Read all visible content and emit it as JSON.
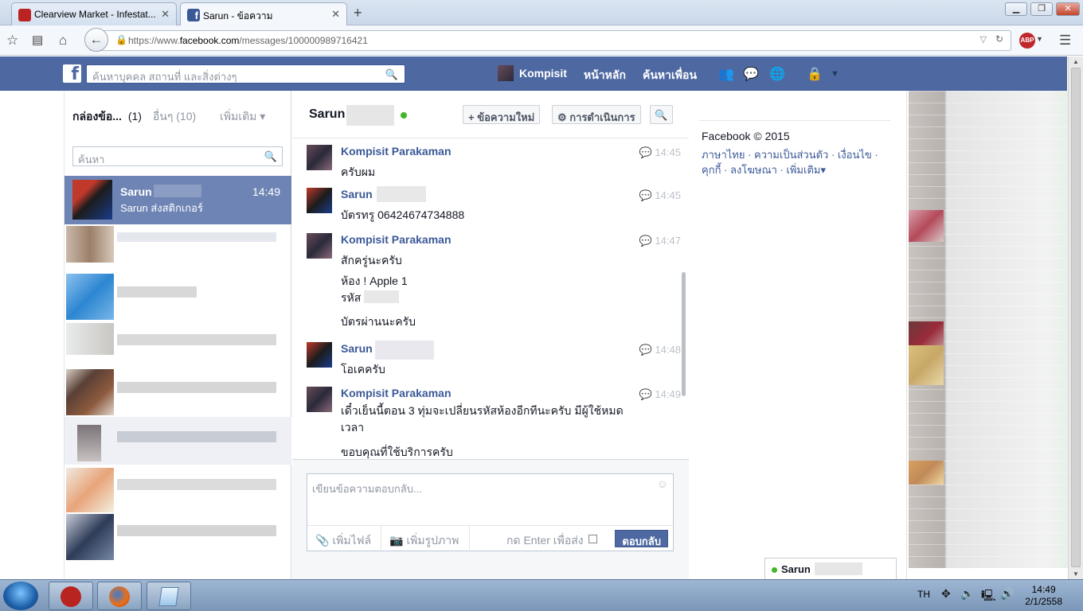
{
  "browser": {
    "tabs": [
      {
        "title": "Clearview Market - Infestat...",
        "active": false
      },
      {
        "title": "Sarun        - ข้อความ",
        "active": true
      }
    ],
    "url_prefix": "https://www.",
    "url_domain": "facebook.com",
    "url_path": "/messages/100000989716421"
  },
  "fb": {
    "logo": "f",
    "search_placeholder": "ค้นหาบุคคล สถานที่ และสิ่งต่างๆ",
    "profile_name": "Kompisit",
    "home": "หน้าหลัก",
    "find_friends": "ค้นหาเพื่อน"
  },
  "left": {
    "inbox_label": "กล่องข้อ...",
    "inbox_count": "(1)",
    "other_label": "อื่นๆ (10)",
    "more_label": "เพิ่มเติม ▾",
    "search_placeholder": "ค้นหา",
    "active_conv": {
      "name": "Sarun",
      "time": "14:49",
      "snippet": "Sarun ส่งสติกเกอร์"
    }
  },
  "thread_header": {
    "name": "Sarun",
    "new_message": "ข้อความใหม่",
    "actions": "การดำเนินการ"
  },
  "messages": [
    {
      "sender": "Kompisit Parakaman",
      "time": "14:45",
      "lines": [
        "ครับผม"
      ]
    },
    {
      "sender": "Sarun",
      "time": "14:45",
      "lines": [
        "บัตรทรู 06424674734888"
      ]
    },
    {
      "sender": "Kompisit Parakaman",
      "time": "14:47",
      "lines": [
        "สักครู่นะครับ"
      ]
    },
    {
      "sender": "",
      "time": "",
      "lines": [
        "ห้อง ! Apple 1",
        "รหัส"
      ]
    },
    {
      "sender": "",
      "time": "",
      "lines": [
        "บัตรผ่านนะครับ"
      ]
    },
    {
      "sender": "Sarun",
      "time": "14:48",
      "lines": [
        "โอเคครับ"
      ]
    },
    {
      "sender": "Kompisit Parakaman",
      "time": "14:49",
      "lines": [
        "เดี๋วเย็นนี้ตอน 3 ทุ่มจะเปลี่ยนรหัสห้องอีกทีนะครับ มีผู้ใช้หมด",
        "เวลา"
      ]
    },
    {
      "sender": "",
      "time": "",
      "lines": [
        "ขอบคุณที่ใช้บริการครับ"
      ]
    }
  ],
  "composer": {
    "placeholder": "เขียนข้อความตอบกลับ...",
    "add_files": "เพิ่มไฟล์",
    "add_photos": "เพิ่มรูปภาพ",
    "press_enter": "กด Enter เพื่อส่ง",
    "reply_button": "ตอบกลับ"
  },
  "right": {
    "copyright": "Facebook © 2015",
    "links1": "ภาษาไทย · ความเป็นส่วนตัว · เงื่อนไข ·",
    "links2": "คุกกี้ · ลงโฆษณา · เพิ่มเติม▾"
  },
  "chat_tab": {
    "name": "Sarun"
  },
  "taskbar": {
    "lang": "TH",
    "time": "14:49",
    "date": "2/1/2558"
  },
  "colors": {
    "fb_blue": "#4e69a2",
    "link_blue": "#3b5998",
    "online_green": "#42b72a"
  }
}
